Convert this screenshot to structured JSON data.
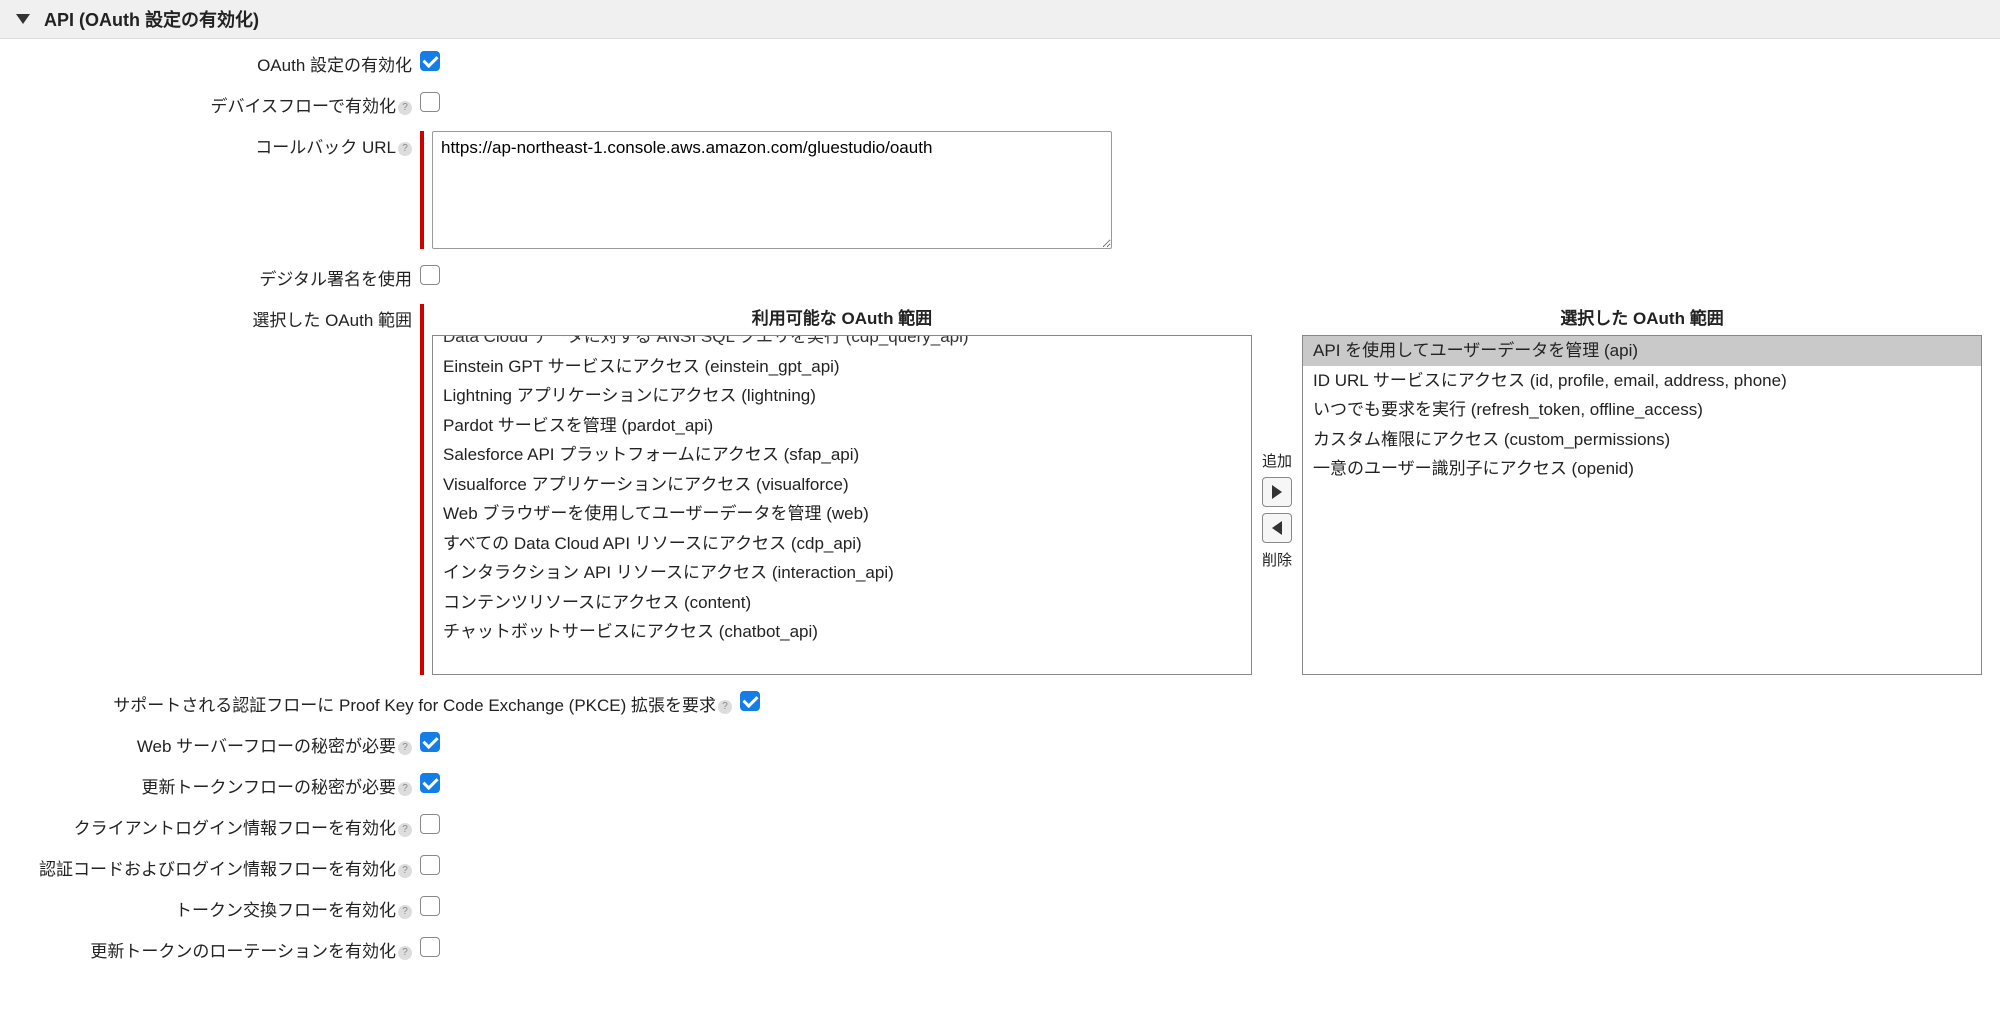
{
  "section": {
    "title": "API (OAuth 設定の有効化)"
  },
  "fields": {
    "enable_oauth": {
      "label": "OAuth 設定の有効化",
      "checked": true
    },
    "device_flow": {
      "label": "デバイスフローで有効化",
      "checked": false
    },
    "callback_url": {
      "label": "コールバック URL",
      "value": "https://ap-northeast-1.console.aws.amazon.com/gluestudio/oauth"
    },
    "digital_sig": {
      "label": "デジタル署名を使用",
      "checked": false
    },
    "scopes": {
      "label": "選択した OAuth 範囲"
    },
    "pkce": {
      "label": "サポートされる認証フローに Proof Key for Code Exchange (PKCE) 拡張を要求",
      "checked": true
    },
    "web_secret": {
      "label": "Web サーバーフローの秘密が必要",
      "checked": true
    },
    "refresh_secret": {
      "label": "更新トークンフローの秘密が必要",
      "checked": true
    },
    "client_creds": {
      "label": "クライアントログイン情報フローを有効化",
      "checked": false
    },
    "auth_code": {
      "label": "認証コードおよびログイン情報フローを有効化",
      "checked": false
    },
    "token_exch": {
      "label": "トークン交換フローを有効化",
      "checked": false
    },
    "token_rotation": {
      "label": "更新トークンのローテーションを有効化",
      "checked": false
    }
  },
  "scopes_panel": {
    "available_header": "利用可能な OAuth 範囲",
    "selected_header": "選択した OAuth 範囲",
    "add_label": "追加",
    "remove_label": "削除",
    "available": [
      "Data Cloud データに対する ANSI SQL クエリを実行 (cdp_query_api)",
      "Einstein GPT サービスにアクセス (einstein_gpt_api)",
      "Lightning アプリケーションにアクセス (lightning)",
      "Pardot サービスを管理 (pardot_api)",
      "Salesforce API プラットフォームにアクセス (sfap_api)",
      "Visualforce アプリケーションにアクセス (visualforce)",
      "Web ブラウザーを使用してユーザーデータを管理 (web)",
      "すべての Data Cloud API リソースにアクセス (cdp_api)",
      "インタラクション API リソースにアクセス (interaction_api)",
      "コンテンツリソースにアクセス (content)",
      "チャットボットサービスにアクセス (chatbot_api)"
    ],
    "selected": [
      "API を使用してユーザーデータを管理 (api)",
      "ID URL サービスにアクセス (id, profile, email, address, phone)",
      "いつでも要求を実行 (refresh_token, offline_access)",
      "カスタム権限にアクセス (custom_permissions)",
      "一意のユーザー識別子にアクセス (openid)"
    ],
    "selected_highlight_index": 0
  }
}
